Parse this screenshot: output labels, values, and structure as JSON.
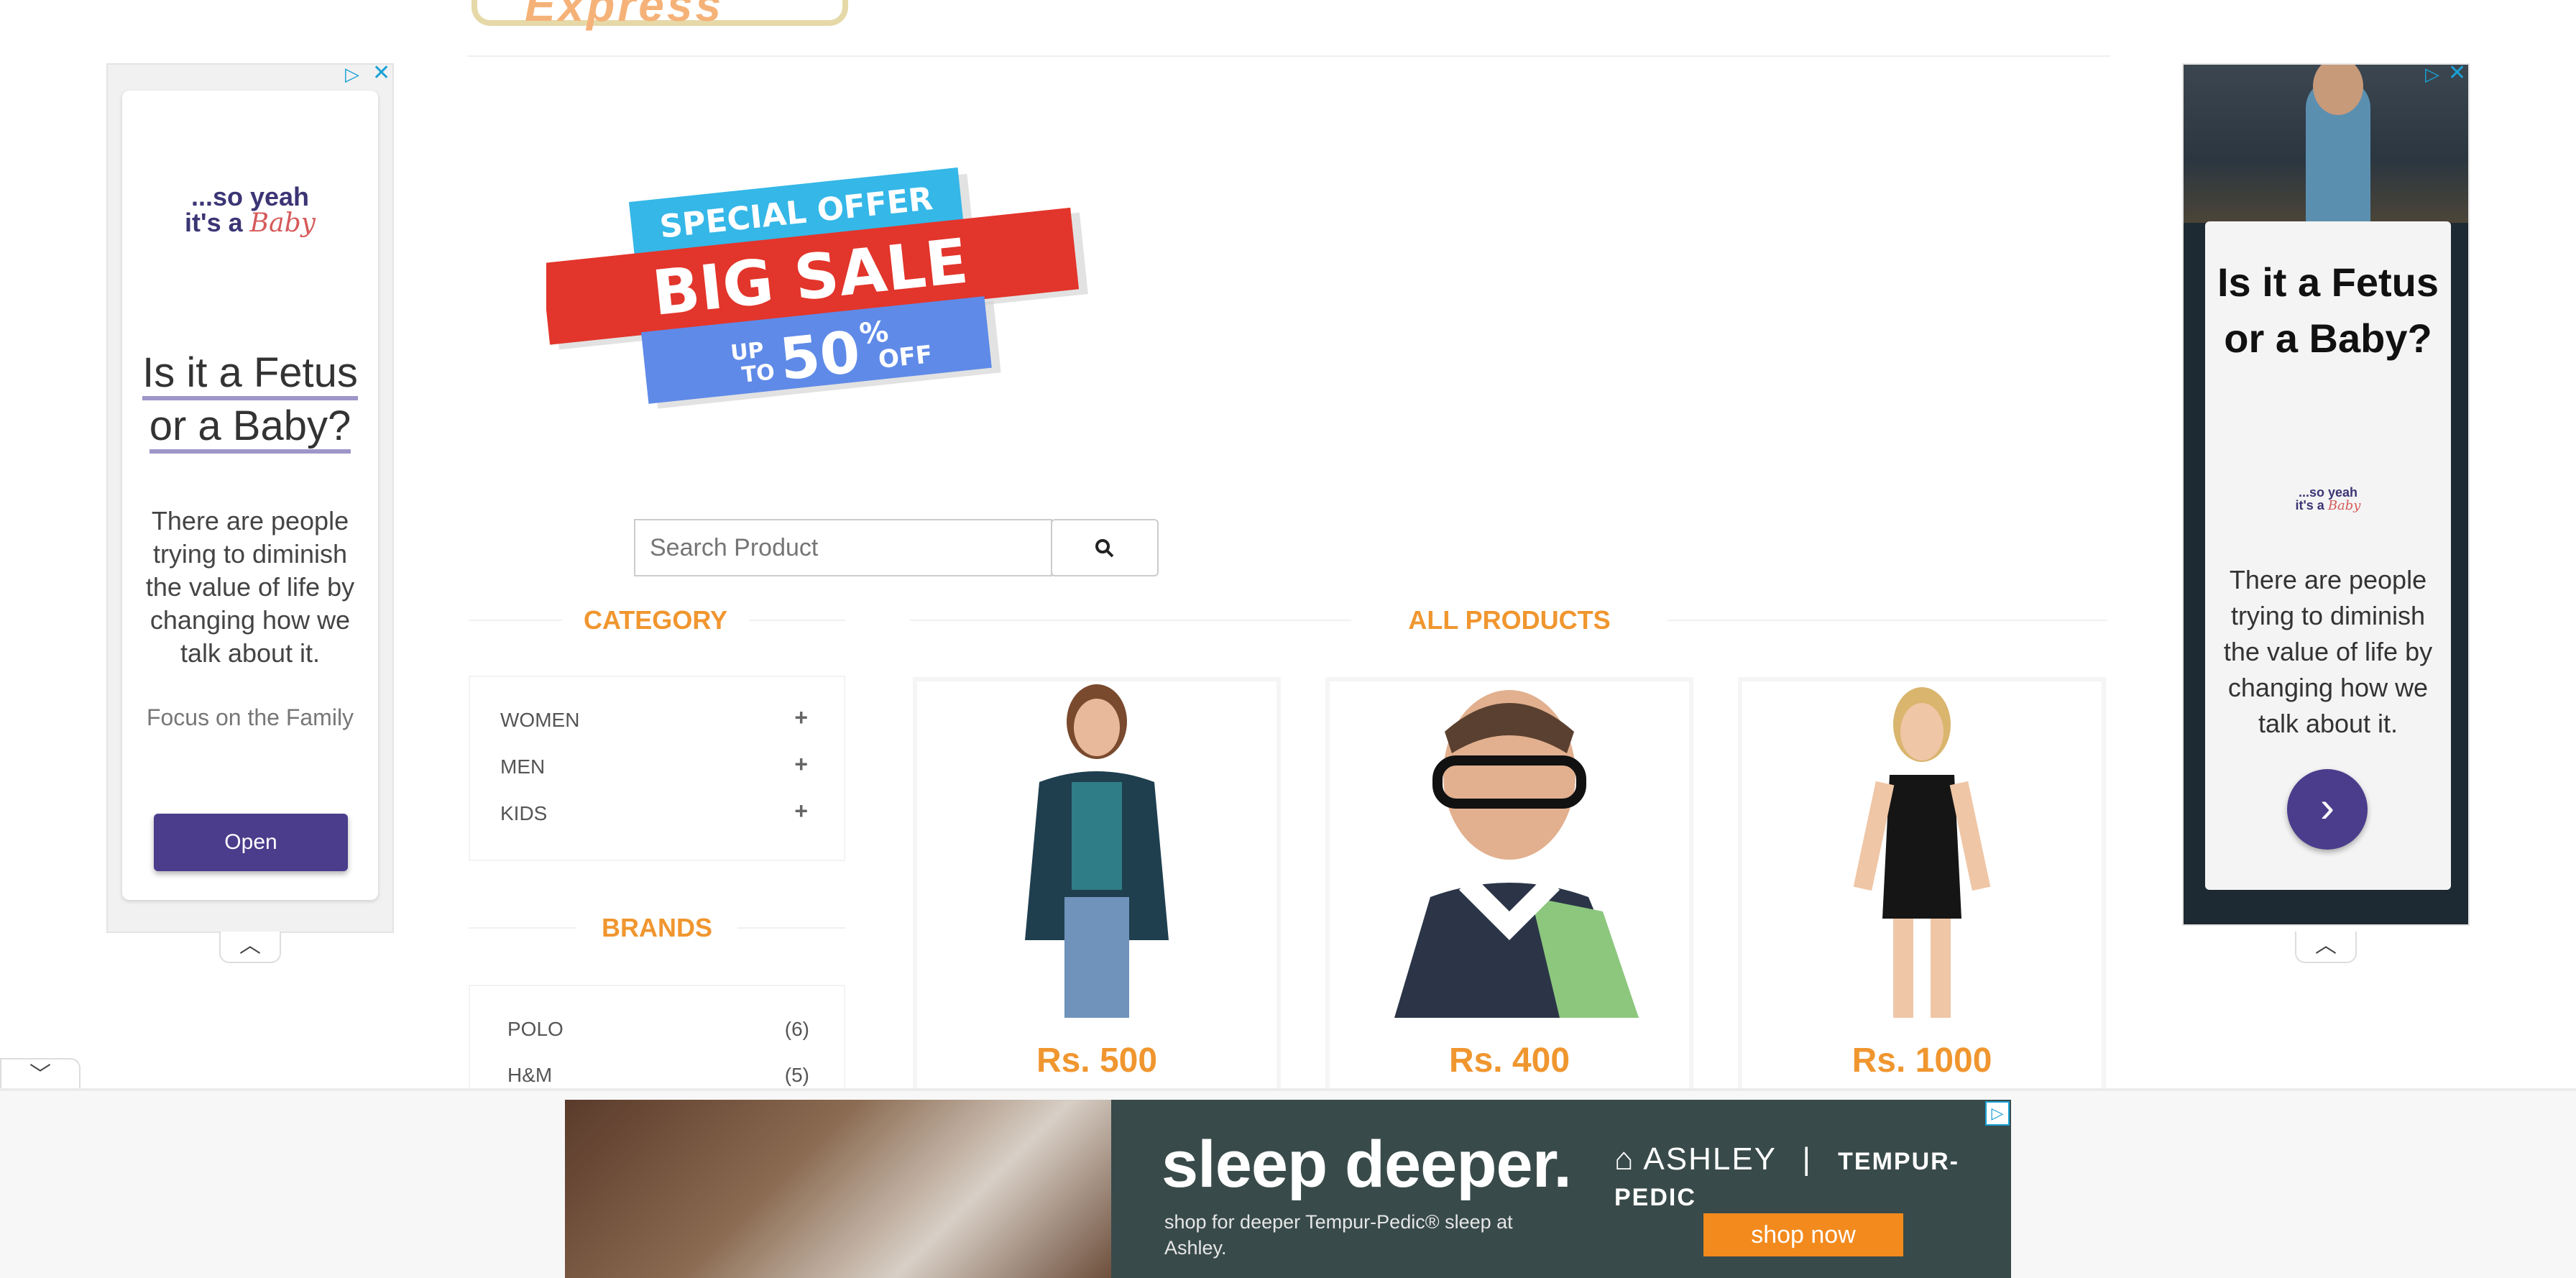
{
  "header": {
    "logo_text": "Express"
  },
  "ad_left": {
    "brand_line1": "...so yeah",
    "brand_line2": "it's a",
    "brand_line3": "Baby",
    "title": "Is it a Fetus or a Baby?",
    "description": "There are people trying to diminish the value of life by changing how we talk about it.",
    "advertiser": "Focus on the Family",
    "button_label": "Open",
    "adchoices_icon": "adchoices-icon",
    "close_icon": "close-icon"
  },
  "ad_right": {
    "title": "Is it a Fetus or a Baby?",
    "brand_line1": "...so yeah",
    "brand_line2": "it's a",
    "brand_line3": "Baby",
    "description": "There are people trying to diminish the value of life by changing how we talk about it.",
    "arrow": "›"
  },
  "banner": {
    "line1": "SPECIAL OFFER",
    "line2": "BIG SALE",
    "up": "UP",
    "to": "TO",
    "percent": "50",
    "pct_sign": "%",
    "off": "OFF"
  },
  "search": {
    "placeholder": "Search Product",
    "button_icon": "search-icon"
  },
  "category": {
    "title": "CATEGORY",
    "items": [
      {
        "label": "WOMEN"
      },
      {
        "label": "MEN"
      },
      {
        "label": "KIDS"
      }
    ]
  },
  "brands": {
    "title": "BRANDS",
    "items": [
      {
        "label": "POLO",
        "count": "(6)"
      },
      {
        "label": "H&M",
        "count": "(5)"
      }
    ]
  },
  "products": {
    "title": "ALL PRODUCTS",
    "items": [
      {
        "price": "Rs. 500"
      },
      {
        "price": "Rs. 400"
      },
      {
        "price": "Rs. 1000"
      }
    ]
  },
  "bottom_ad": {
    "headline": "sleep deeper.",
    "subline": "shop for deeper Tempur-Pedic® sleep at Ashley.",
    "brand_a": "ASHLEY",
    "brand_b": "TEMPUR-PEDIC",
    "cta": "shop now"
  },
  "colors": {
    "accent": "#f0962f",
    "ad_purple": "#4b3d8c"
  }
}
